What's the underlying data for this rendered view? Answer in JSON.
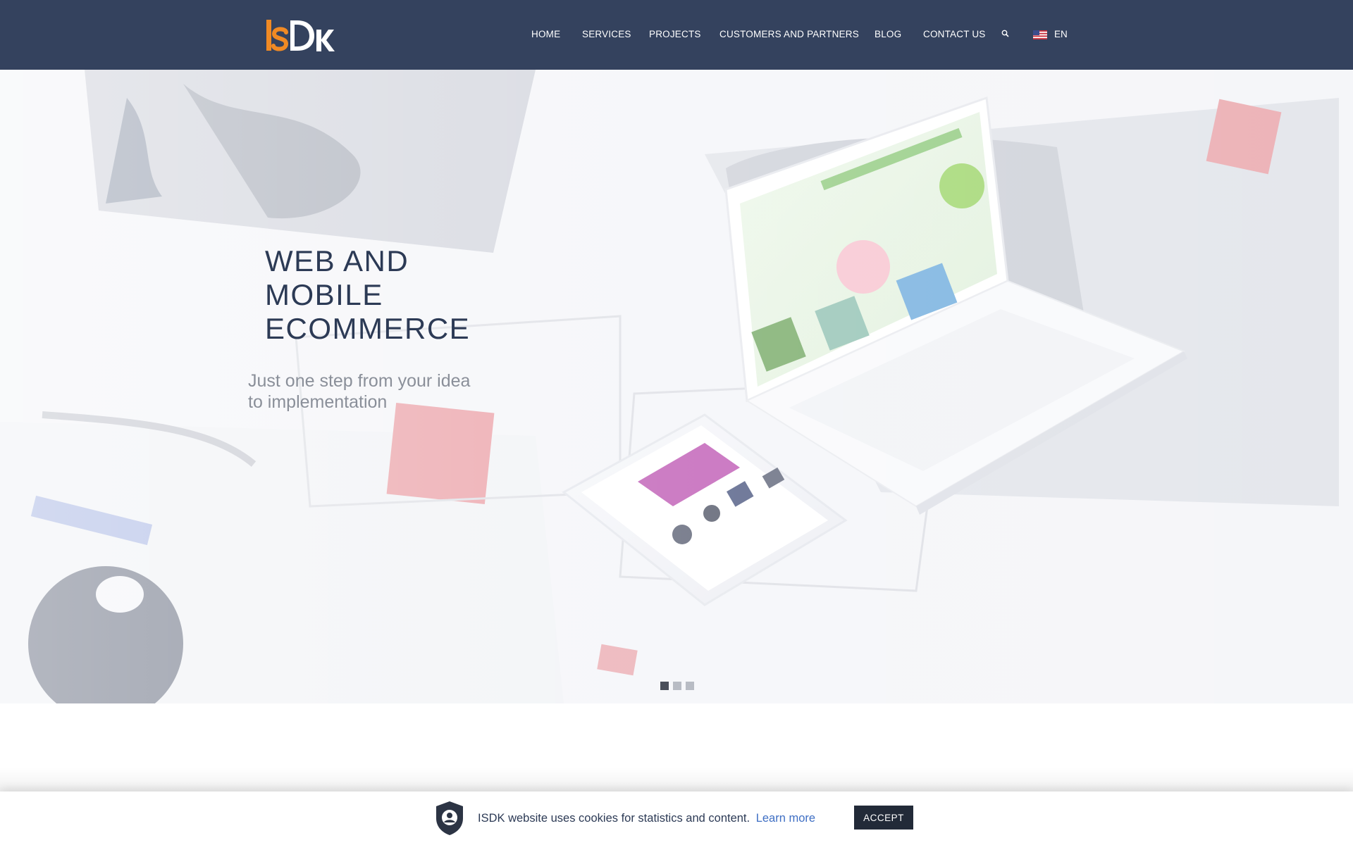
{
  "header": {
    "nav": [
      {
        "label": "HOME"
      },
      {
        "label": "SERVICES"
      },
      {
        "label": "PROJECTS"
      },
      {
        "label": "CUSTOMERS AND PARTNERS"
      },
      {
        "label": "BLOG"
      },
      {
        "label": "CONTACT US"
      }
    ],
    "search_icon": "search-icon",
    "language": {
      "label": "EN",
      "flag": "us-flag-icon"
    }
  },
  "hero": {
    "title_lines": [
      "WEB AND",
      "MOBILE",
      "ECOMMERCE"
    ],
    "subtitle_lines": [
      "Just one step from your idea",
      "to implementation"
    ],
    "slides_total": 3,
    "active_slide": 1
  },
  "cookie_bar": {
    "icon": "privacy-shield-icon",
    "message": "ISDK website uses cookies for statistics and content.",
    "link_label": "Learn more",
    "accept_label": "ACCEPT"
  },
  "colors": {
    "header_bg": "#34425e",
    "brand_orange": "#f08a24",
    "title_color": "#2c3a55",
    "link_color": "#3f6fc4",
    "button_bg": "#222a38"
  }
}
